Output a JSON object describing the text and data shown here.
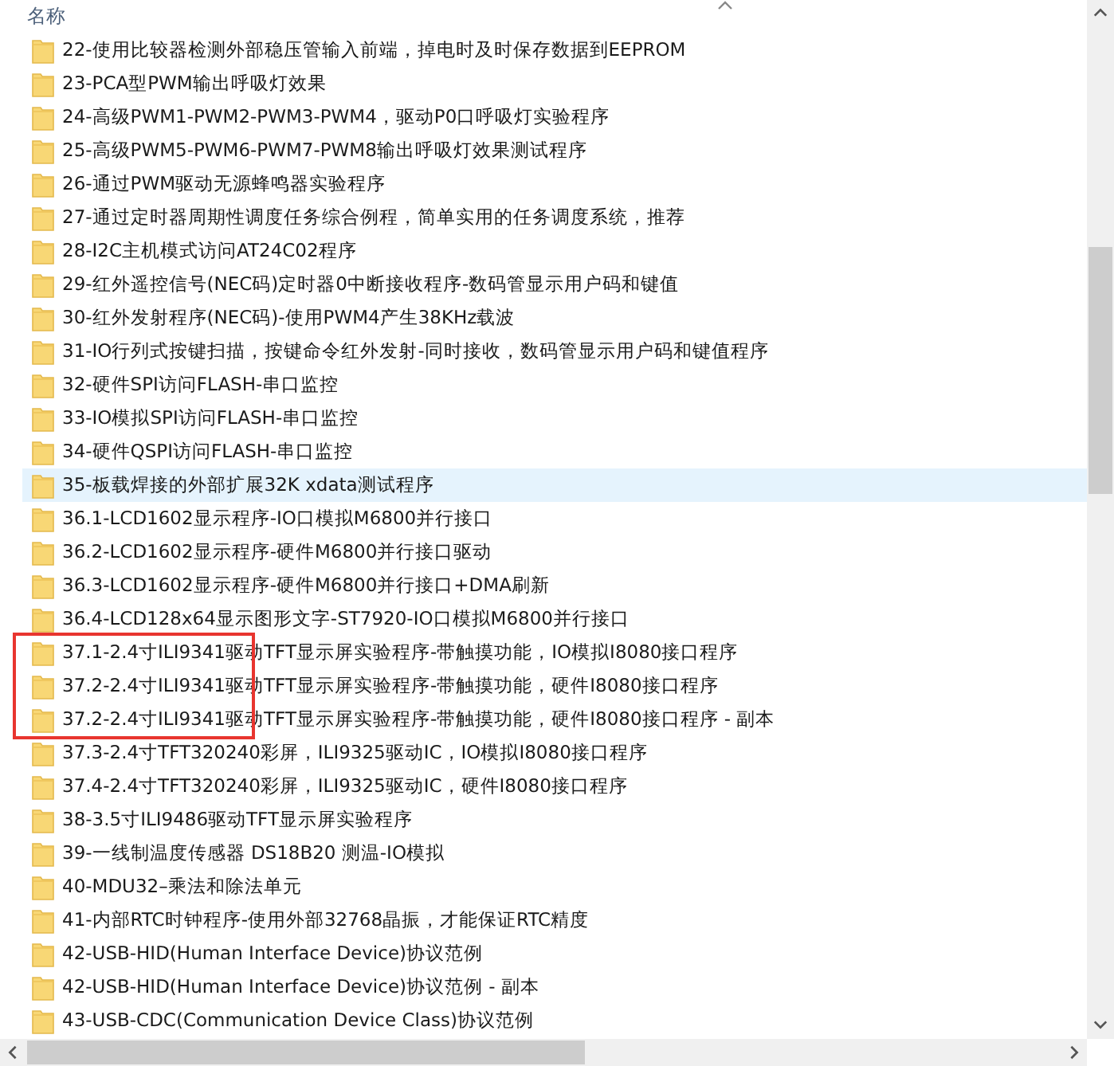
{
  "header": {
    "column": "名称"
  },
  "rows": [
    {
      "name": "22-使用比较器检测外部稳压管输入前端，掉电时及时保存数据到EEPROM",
      "highlighted": false,
      "marked": false
    },
    {
      "name": "23-PCA型PWM输出呼吸灯效果",
      "highlighted": false,
      "marked": false
    },
    {
      "name": "24-高级PWM1-PWM2-PWM3-PWM4，驱动P0口呼吸灯实验程序",
      "highlighted": false,
      "marked": false
    },
    {
      "name": "25-高级PWM5-PWM6-PWM7-PWM8输出呼吸灯效果测试程序",
      "highlighted": false,
      "marked": false
    },
    {
      "name": "26-通过PWM驱动无源蜂鸣器实验程序",
      "highlighted": false,
      "marked": false
    },
    {
      "name": "27-通过定时器周期性调度任务综合例程，简单实用的任务调度系统，推荐",
      "highlighted": false,
      "marked": false
    },
    {
      "name": "28-I2C主机模式访问AT24C02程序",
      "highlighted": false,
      "marked": false
    },
    {
      "name": "29-红外遥控信号(NEC码)定时器0中断接收程序-数码管显示用户码和键值",
      "highlighted": false,
      "marked": false
    },
    {
      "name": "30-红外发射程序(NEC码)-使用PWM4产生38KHz载波",
      "highlighted": false,
      "marked": false
    },
    {
      "name": "31-IO行列式按键扫描，按键命令红外发射-同时接收，数码管显示用户码和键值程序",
      "highlighted": false,
      "marked": false
    },
    {
      "name": "32-硬件SPI访问FLASH-串口监控",
      "highlighted": false,
      "marked": false
    },
    {
      "name": "33-IO模拟SPI访问FLASH-串口监控",
      "highlighted": false,
      "marked": false
    },
    {
      "name": "34-硬件QSPI访问FLASH-串口监控",
      "highlighted": false,
      "marked": false
    },
    {
      "name": "35-板载焊接的外部扩展32K xdata测试程序",
      "highlighted": true,
      "marked": false
    },
    {
      "name": "36.1-LCD1602显示程序-IO口模拟M6800并行接口",
      "highlighted": false,
      "marked": false
    },
    {
      "name": "36.2-LCD1602显示程序-硬件M6800并行接口驱动",
      "highlighted": false,
      "marked": false
    },
    {
      "name": "36.3-LCD1602显示程序-硬件M6800并行接口+DMA刷新",
      "highlighted": false,
      "marked": false
    },
    {
      "name": "36.4-LCD128x64显示图形文字-ST7920-IO口模拟M6800并行接口",
      "highlighted": false,
      "marked": false
    },
    {
      "name": "37.1-2.4寸ILI9341驱动TFT显示屏实验程序-带触摸功能，IO模拟I8080接口程序",
      "highlighted": false,
      "marked": true
    },
    {
      "name": "37.2-2.4寸ILI9341驱动TFT显示屏实验程序-带触摸功能，硬件I8080接口程序",
      "highlighted": false,
      "marked": true
    },
    {
      "name": "37.2-2.4寸ILI9341驱动TFT显示屏实验程序-带触摸功能，硬件I8080接口程序 - 副本",
      "highlighted": false,
      "marked": true
    },
    {
      "name": "37.3-2.4寸TFT320240彩屏，ILI9325驱动IC，IO模拟I8080接口程序",
      "highlighted": false,
      "marked": false
    },
    {
      "name": "37.4-2.4寸TFT320240彩屏，ILI9325驱动IC，硬件I8080接口程序",
      "highlighted": false,
      "marked": false
    },
    {
      "name": "38-3.5寸ILI9486驱动TFT显示屏实验程序",
      "highlighted": false,
      "marked": false
    },
    {
      "name": "39-一线制温度传感器 DS18B20 测温-IO模拟",
      "highlighted": false,
      "marked": false
    },
    {
      "name": "40-MDU32–乘法和除法单元",
      "highlighted": false,
      "marked": false
    },
    {
      "name": "41-内部RTC时钟程序-使用外部32768晶振，才能保证RTC精度",
      "highlighted": false,
      "marked": false
    },
    {
      "name": "42-USB-HID(Human Interface Device)协议范例",
      "highlighted": false,
      "marked": false
    },
    {
      "name": "42-USB-HID(Human Interface Device)协议范例 - 副本",
      "highlighted": false,
      "marked": false
    },
    {
      "name": "43-USB-CDC(Communication Device Class)协议范例",
      "highlighted": false,
      "marked": false
    }
  ]
}
